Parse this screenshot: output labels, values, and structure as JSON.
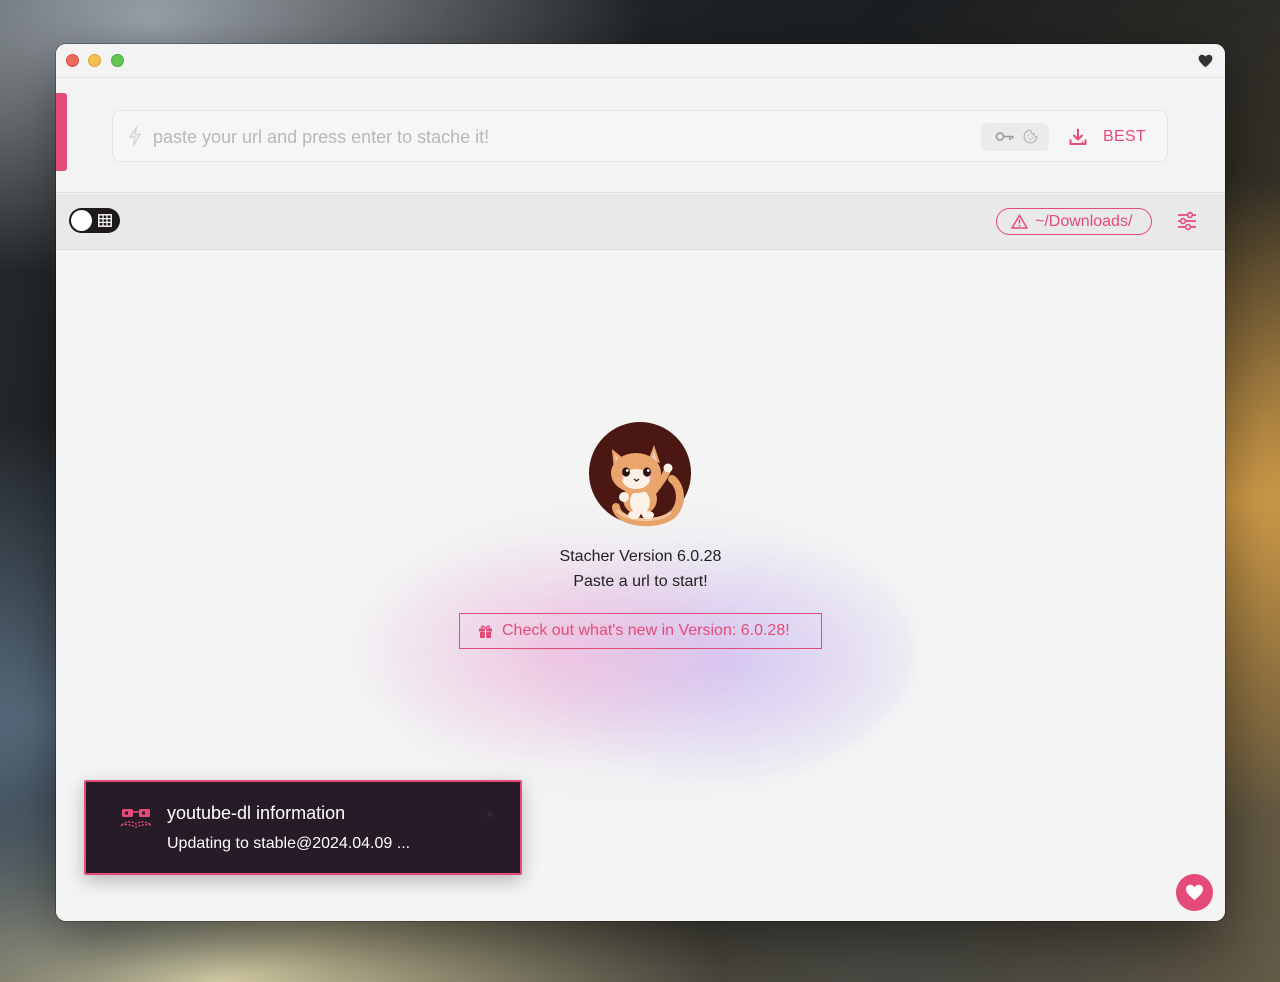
{
  "window": {
    "controls": [
      "close",
      "minimize",
      "zoom"
    ],
    "corner_icon": "heart-icon"
  },
  "url_bar": {
    "placeholder": "paste your url and press enter to stache it!",
    "value": "",
    "leading_icon": "bolt-icon",
    "credential_icons": [
      "key-icon",
      "cookie-icon"
    ],
    "download_icon": "download-icon",
    "format_label": "BEST"
  },
  "toolbar": {
    "view_toggle_icon": "table-icon",
    "view_toggle_on": false,
    "download_folder": "~/Downloads/",
    "folder_icon": "warning-icon",
    "settings_icon": "sliders-icon"
  },
  "main": {
    "logo": "cat-mascot-logo",
    "version_text": "Stacher Version 6.0.28",
    "hint_text": "Paste a url to start!",
    "whats_new_label": "Check out what's new in Version: 6.0.28!",
    "whats_new_icon": "gift-icon"
  },
  "toast": {
    "icon": "mustache-glasses-icon",
    "title": "youtube-dl information",
    "message": "Updating to stable@2024.04.09 ...",
    "close_label": "×"
  },
  "support_button_icon": "heart-icon",
  "colors": {
    "accent": "#e54b78",
    "toast_background": "#261b26",
    "window_background": "#f4f4f4",
    "toolbar_background": "#e9e9e9"
  }
}
